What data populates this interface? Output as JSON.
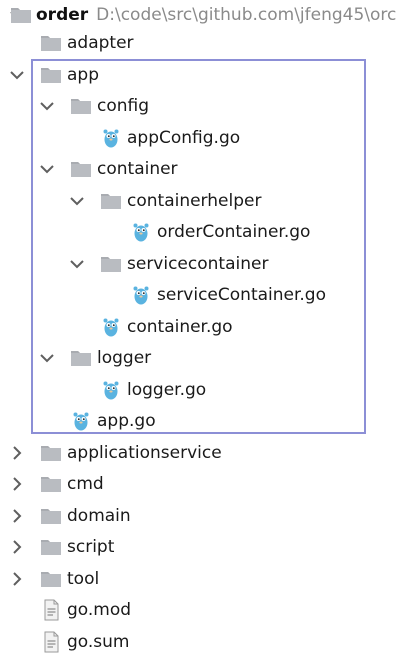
{
  "tree": {
    "root": {
      "name": "order",
      "path": "D:\\code\\src\\github.com\\jfeng45\\orc"
    },
    "items": [
      {
        "label": "adapter",
        "kind": "folder",
        "expanded": false
      },
      {
        "label": "app",
        "kind": "folder",
        "expanded": true
      },
      {
        "label": "config",
        "kind": "folder",
        "expanded": true
      },
      {
        "label": "appConfig.go",
        "kind": "go-file"
      },
      {
        "label": "container",
        "kind": "folder",
        "expanded": true
      },
      {
        "label": "containerhelper",
        "kind": "folder",
        "expanded": true
      },
      {
        "label": "orderContainer.go",
        "kind": "go-file"
      },
      {
        "label": "servicecontainer",
        "kind": "folder",
        "expanded": true
      },
      {
        "label": "serviceContainer.go",
        "kind": "go-file"
      },
      {
        "label": "container.go",
        "kind": "go-file"
      },
      {
        "label": "logger",
        "kind": "folder",
        "expanded": true
      },
      {
        "label": "logger.go",
        "kind": "go-file"
      },
      {
        "label": "app.go",
        "kind": "go-file"
      },
      {
        "label": "applicationservice",
        "kind": "folder",
        "expanded": false
      },
      {
        "label": "cmd",
        "kind": "folder",
        "expanded": false
      },
      {
        "label": "domain",
        "kind": "folder",
        "expanded": false
      },
      {
        "label": "script",
        "kind": "folder",
        "expanded": false
      },
      {
        "label": "tool",
        "kind": "folder",
        "expanded": false
      },
      {
        "label": "go.mod",
        "kind": "mod-file"
      },
      {
        "label": "go.sum",
        "kind": "mod-file"
      }
    ]
  },
  "colors": {
    "folder": "#b9bcc1",
    "folder_tab": "#a9acb1",
    "selection": "#8c8fd6",
    "gopher": "#5ab3e0",
    "chevron": "#5f5f5f"
  }
}
